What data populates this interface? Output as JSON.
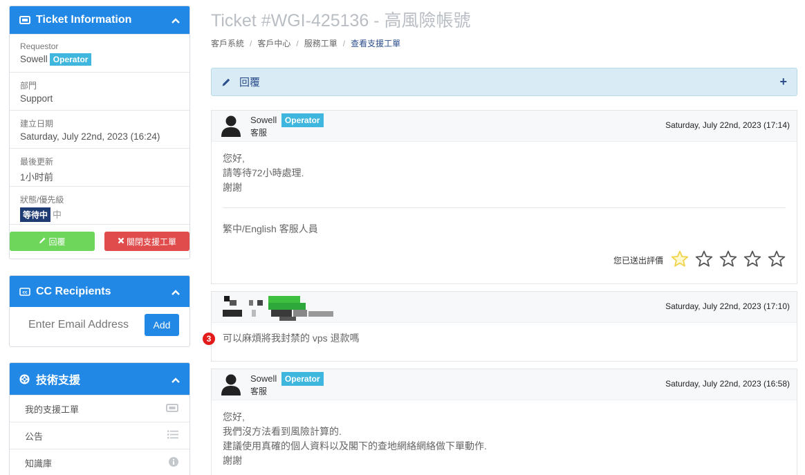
{
  "ticket_info": {
    "title": "Ticket Information",
    "requestor_label": "Requestor",
    "requestor_name": "Sowell",
    "requestor_badge": "Operator",
    "department_label": "部門",
    "department_value": "Support",
    "created_label": "建立日期",
    "created_value": "Saturday, July 22nd, 2023 (16:24)",
    "updated_label": "最後更新",
    "updated_value": "1小时前",
    "status_label": "狀態/優先級",
    "status_badge": "等待中",
    "priority_value": "中",
    "reply_button": "回覆",
    "close_button": "關閉支援工單"
  },
  "cc": {
    "title": "CC Recipients",
    "placeholder": "Enter Email Address",
    "add_button": "Add"
  },
  "support": {
    "title": "技術支援",
    "items": [
      {
        "label": "我的支援工單",
        "icon": "ticket-icon"
      },
      {
        "label": "公告",
        "icon": "list-icon"
      },
      {
        "label": "知識庫",
        "icon": "info-icon"
      }
    ]
  },
  "page": {
    "title": "Ticket #WGI-425136 - 高風險帳號",
    "breadcrumb": [
      "客戶系統",
      "客戶中心",
      "服務工單",
      "查看支援工單"
    ],
    "reply_bar_label": "回覆"
  },
  "messages": [
    {
      "author": "Sowell",
      "badge": "Operator",
      "role": "客服",
      "timestamp": "Saturday, July 22nd, 2023 (17:14)",
      "lines": [
        "您好,",
        "請等待72小時處理.",
        "謝謝"
      ],
      "signature": "繁中/English 客服人員",
      "rating_label": "您已送出評價",
      "rating_value": 1,
      "rating_max": 5
    },
    {
      "timestamp": "Saturday, July 22nd, 2023 (17:10)",
      "text": "可以麻煩將我封禁的 vps 退款嗎",
      "annotation": "3"
    },
    {
      "author": "Sowell",
      "badge": "Operator",
      "role": "客服",
      "timestamp": "Saturday, July 22nd, 2023 (16:58)",
      "lines": [
        "您好,",
        "我們沒方法看到風險計算的.",
        "建議使用真確的個人資料以及閣下的查地網絡網絡做下單動作.",
        "謝謝"
      ]
    }
  ],
  "colors": {
    "primary": "#2288e5",
    "operator_badge": "#3fb6dd",
    "status_badge": "#1f3b73",
    "reply_green": "#6ed65a",
    "close_red": "#e04b4b",
    "star_active": "#f0d34a"
  }
}
